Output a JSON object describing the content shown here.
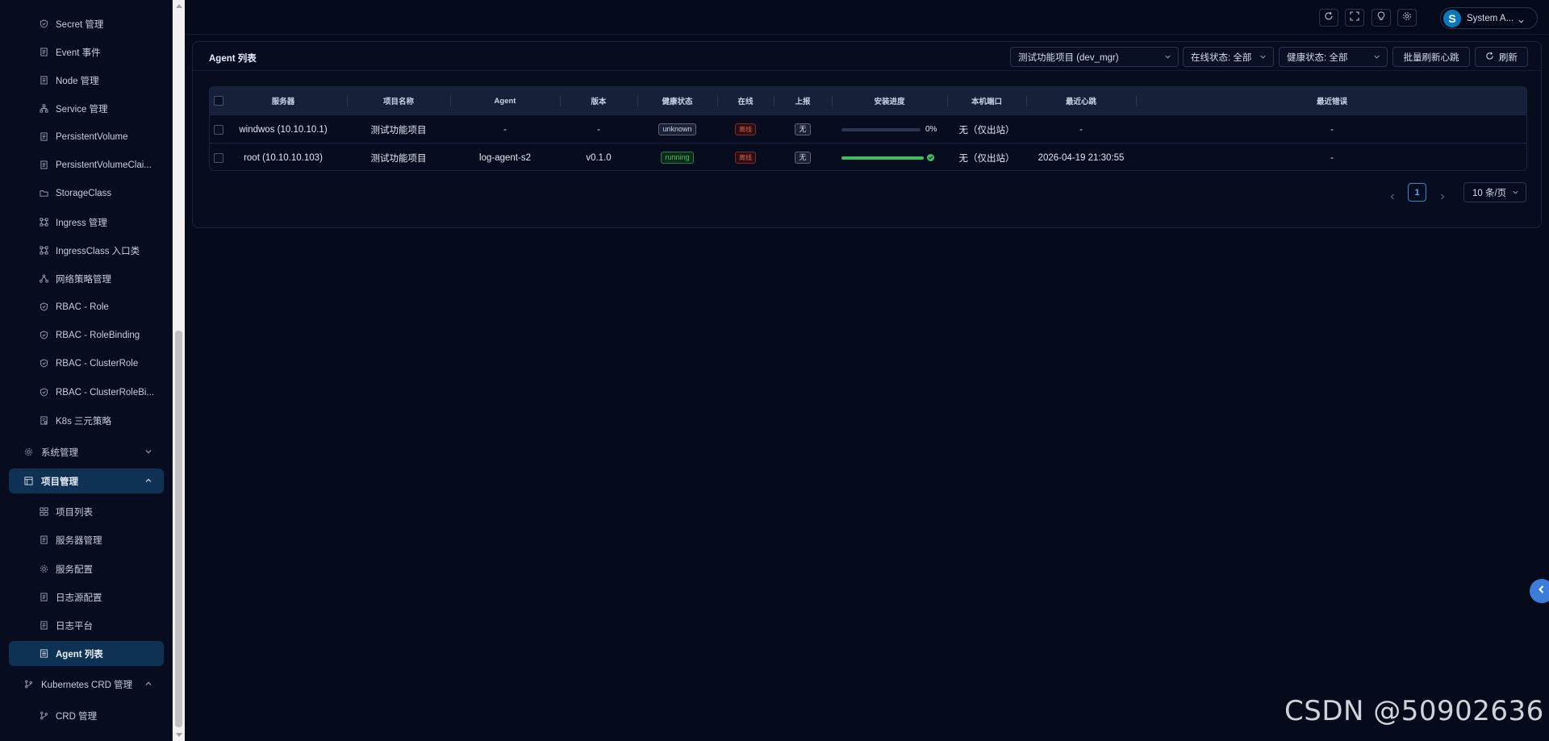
{
  "sidebar": {
    "items": [
      {
        "label": "Secret 管理",
        "icon": "shield-icon"
      },
      {
        "label": "Event 事件",
        "icon": "document-icon"
      },
      {
        "label": "Node 管理",
        "icon": "document-icon"
      },
      {
        "label": "Service 管理",
        "icon": "network-icon"
      },
      {
        "label": "PersistentVolume",
        "icon": "document-icon"
      },
      {
        "label": "PersistentVolumeClai...",
        "icon": "document-icon"
      },
      {
        "label": "StorageClass",
        "icon": "folder-icon"
      },
      {
        "label": "Ingress 管理",
        "icon": "nodes-icon"
      },
      {
        "label": "IngressClass 入口类",
        "icon": "nodes-icon"
      },
      {
        "label": "网络策略管理",
        "icon": "share-icon"
      },
      {
        "label": "RBAC - Role",
        "icon": "shield-icon"
      },
      {
        "label": "RBAC - RoleBinding",
        "icon": "shield-icon"
      },
      {
        "label": "RBAC - ClusterRole",
        "icon": "shield-icon"
      },
      {
        "label": "RBAC - ClusterRoleBi...",
        "icon": "shield-icon"
      },
      {
        "label": "K8s 三元策略",
        "icon": "policy-icon"
      }
    ],
    "system_group": {
      "label": "系统管理",
      "icon": "gear-icon"
    },
    "project_group": {
      "label": "项目管理",
      "icon": "layout-icon"
    },
    "project_items": [
      {
        "label": "项目列表",
        "icon": "grid-icon"
      },
      {
        "label": "服务器管理",
        "icon": "document-icon"
      },
      {
        "label": "服务配置",
        "icon": "gear-icon"
      },
      {
        "label": "日志源配置",
        "icon": "document-icon"
      },
      {
        "label": "日志平台",
        "icon": "document-icon"
      },
      {
        "label": "Agent 列表",
        "icon": "list-icon"
      }
    ],
    "crd_group": {
      "label": "Kubernetes CRD 管理",
      "icon": "branch-icon"
    },
    "crd_items": [
      {
        "label": "CRD 管理",
        "icon": "branch-icon"
      }
    ]
  },
  "topbar": {
    "user_initial": "S",
    "user_name": "System A..."
  },
  "panel": {
    "title": "Agent 列表",
    "project_select": "测试功能项目 (dev_mgr)",
    "online_select": "在线状态: 全部",
    "health_select": "健康状态: 全部",
    "batch_button": "批量刷新心跳",
    "refresh_button": "刷新"
  },
  "table": {
    "columns": [
      "服务器",
      "项目名称",
      "Agent",
      "版本",
      "健康状态",
      "在线",
      "上报",
      "安装进度",
      "本机端口",
      "最近心跳",
      "最近错误"
    ],
    "rows": [
      {
        "server": "windwos (10.10.10.1)",
        "project": "测试功能项目",
        "agent": "-",
        "version": "-",
        "health": "unknown",
        "online": "离线",
        "report": "无",
        "progress": 0,
        "progress_label": "0%",
        "port": "无（仅出站）",
        "heartbeat": "-",
        "error": "-"
      },
      {
        "server": "root (10.10.10.103)",
        "project": "测试功能项目",
        "agent": "log-agent-s2",
        "version": "v0.1.0",
        "health": "running",
        "online": "离线",
        "report": "无",
        "progress": 1.0,
        "progress_label": "",
        "port": "无（仅出站）",
        "heartbeat": "2026-04-19 21:30:55",
        "error": "-"
      }
    ]
  },
  "pagination": {
    "current_page": "1",
    "page_size": "10 条/页"
  },
  "watermark": "CSDN @50902636"
}
